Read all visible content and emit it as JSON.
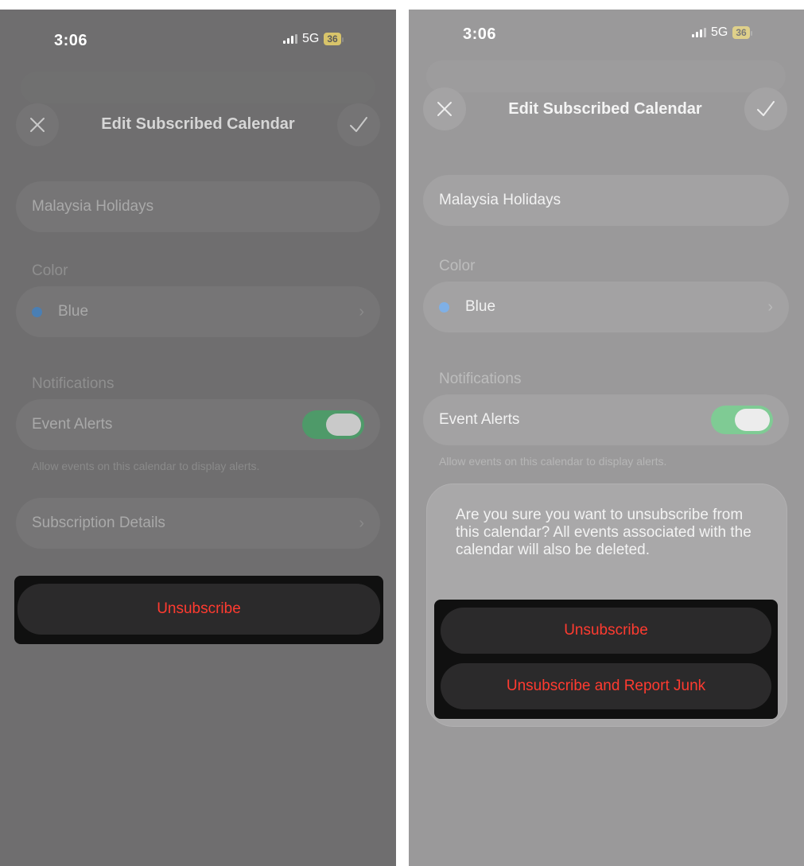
{
  "status_bar": {
    "time": "3:06",
    "network": "5G",
    "battery": "36"
  },
  "nav": {
    "title": "Edit Subscribed Calendar",
    "close_icon": "close-icon",
    "confirm_icon": "checkmark-icon"
  },
  "form": {
    "calendar_name": "Malaysia Holidays",
    "color_label": "Color",
    "color_value": "Blue",
    "color_hex": "#4a90d9",
    "notifications_label": "Notifications",
    "event_alerts_label": "Event Alerts",
    "event_alerts_enabled": true,
    "alerts_footnote": "Allow events on this calendar to display alerts.",
    "subscription_details_label": "Subscription Details"
  },
  "actions": {
    "unsubscribe_label": "Unsubscribe",
    "destructive_color": "#ff3b30"
  },
  "confirm_dialog": {
    "message": "Are you sure you want to unsubscribe from this calendar? All events associated with the calendar will also be deleted.",
    "unsubscribe_label": "Unsubscribe",
    "report_junk_label": "Unsubscribe and Report Junk"
  }
}
